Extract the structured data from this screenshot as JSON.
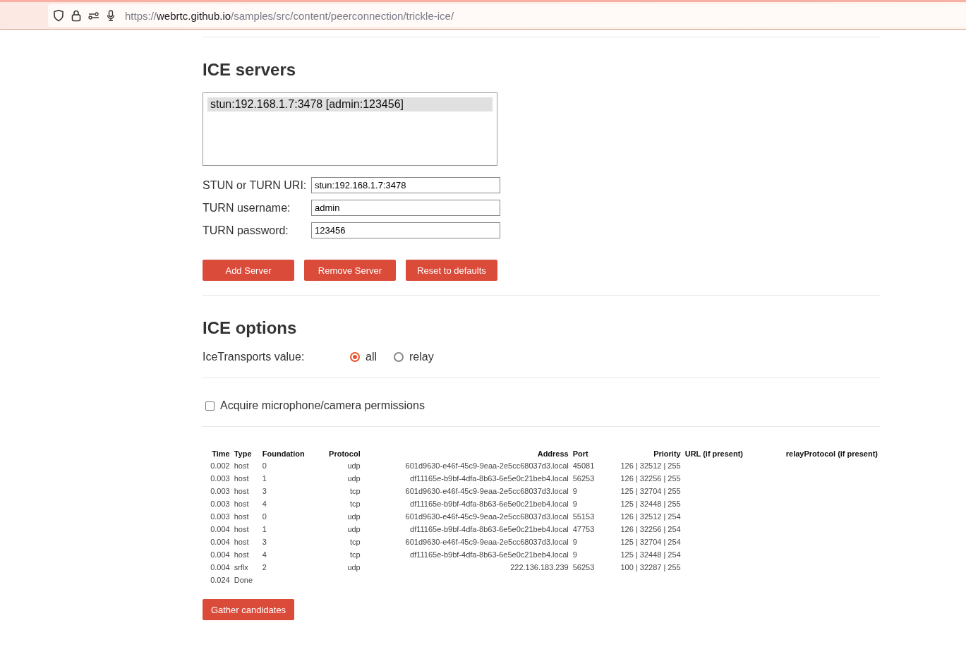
{
  "address_bar": {
    "scheme": "https://",
    "host": "webrtc.github.io",
    "path": "/samples/src/content/peerconnection/trickle-ice/"
  },
  "ice_servers": {
    "heading": "ICE servers",
    "servers": [
      {
        "label": "stun:192.168.1.7:3478 [admin:123456]",
        "selected": true
      }
    ],
    "fields": [
      {
        "label": "STUN or TURN URI:",
        "value": "stun:192.168.1.7:3478"
      },
      {
        "label": "TURN username:",
        "value": "admin"
      },
      {
        "label": "TURN password:",
        "value": "123456"
      }
    ],
    "buttons": [
      "Add Server",
      "Remove Server",
      "Reset to defaults"
    ]
  },
  "ice_options": {
    "heading": "ICE options",
    "label": "IceTransports value:",
    "options": [
      {
        "label": "all",
        "selected": true
      },
      {
        "label": "relay",
        "selected": false
      }
    ]
  },
  "permissions": {
    "label": "Acquire microphone/camera permissions",
    "checked": false
  },
  "candidates": {
    "columns": [
      "Time",
      "Type",
      "Foundation",
      "Protocol",
      "Address",
      "Port",
      "Priority",
      "URL (if present)",
      "relayProtocol (if present)"
    ],
    "rows": [
      {
        "time": "0.002",
        "type": "host",
        "foundation": "0",
        "protocol": "udp",
        "address": "601d9630-e46f-45c9-9eaa-2e5cc68037d3.local",
        "port": "45081",
        "priority": "126 | 32512 | 255"
      },
      {
        "time": "0.003",
        "type": "host",
        "foundation": "1",
        "protocol": "udp",
        "address": "df11165e-b9bf-4dfa-8b63-6e5e0c21beb4.local",
        "port": "56253",
        "priority": "126 | 32256 | 255"
      },
      {
        "time": "0.003",
        "type": "host",
        "foundation": "3",
        "protocol": "tcp",
        "address": "601d9630-e46f-45c9-9eaa-2e5cc68037d3.local",
        "port": "9",
        "priority": "125 | 32704 | 255"
      },
      {
        "time": "0.003",
        "type": "host",
        "foundation": "4",
        "protocol": "tcp",
        "address": "df11165e-b9bf-4dfa-8b63-6e5e0c21beb4.local",
        "port": "9",
        "priority": "125 | 32448 | 255"
      },
      {
        "time": "0.003",
        "type": "host",
        "foundation": "0",
        "protocol": "udp",
        "address": "601d9630-e46f-45c9-9eaa-2e5cc68037d3.local",
        "port": "55153",
        "priority": "126 | 32512 | 254"
      },
      {
        "time": "0.004",
        "type": "host",
        "foundation": "1",
        "protocol": "udp",
        "address": "df11165e-b9bf-4dfa-8b63-6e5e0c21beb4.local",
        "port": "47753",
        "priority": "126 | 32256 | 254"
      },
      {
        "time": "0.004",
        "type": "host",
        "foundation": "3",
        "protocol": "tcp",
        "address": "601d9630-e46f-45c9-9eaa-2e5cc68037d3.local",
        "port": "9",
        "priority": "125 | 32704 | 254"
      },
      {
        "time": "0.004",
        "type": "host",
        "foundation": "4",
        "protocol": "tcp",
        "address": "df11165e-b9bf-4dfa-8b63-6e5e0c21beb4.local",
        "port": "9",
        "priority": "125 | 32448 | 254"
      },
      {
        "time": "0.004",
        "type": "srflx",
        "foundation": "2",
        "protocol": "udp",
        "address": "222.136.183.239",
        "port": "56253",
        "priority": "100 | 32287 | 255"
      },
      {
        "time": "0.024",
        "type": "Done"
      }
    ],
    "button": "Gather candidates"
  }
}
